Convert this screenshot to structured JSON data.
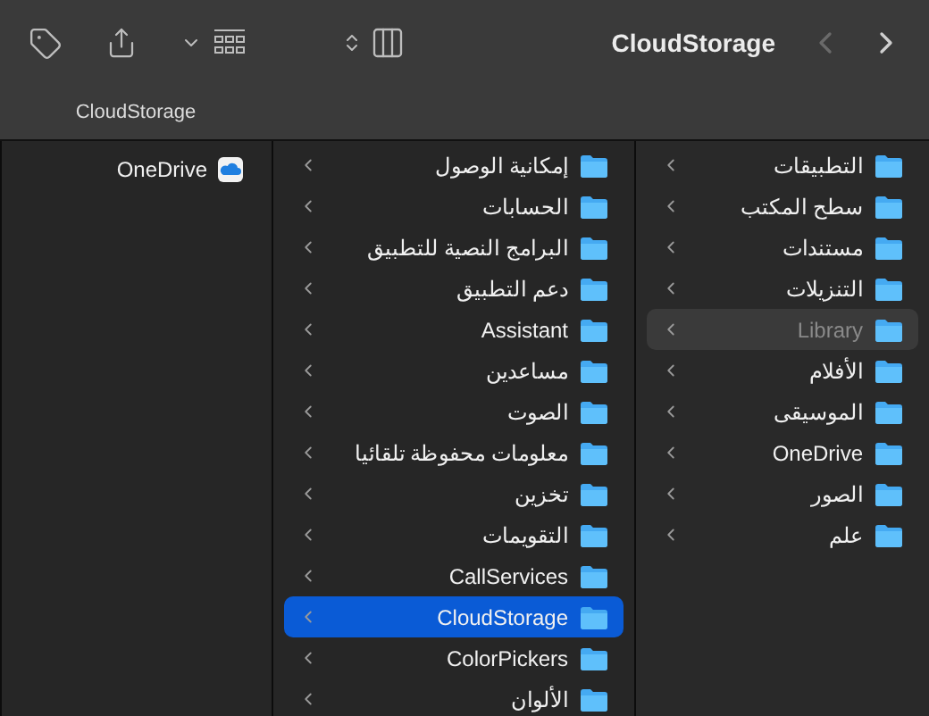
{
  "toolbar": {
    "title": "CloudStorage",
    "tab_label": "CloudStorage"
  },
  "columns": [
    {
      "active": false,
      "items": [
        {
          "label": "التطبيقات",
          "selected": false,
          "dimmed": false
        },
        {
          "label": "سطح المكتب",
          "selected": false,
          "dimmed": false
        },
        {
          "label": "مستندات",
          "selected": false,
          "dimmed": false
        },
        {
          "label": "التنزيلات",
          "selected": false,
          "dimmed": false
        },
        {
          "label": "Library",
          "selected": true,
          "dimmed": true
        },
        {
          "label": "الأفلام",
          "selected": false,
          "dimmed": false
        },
        {
          "label": "الموسيقى",
          "selected": false,
          "dimmed": false
        },
        {
          "label": "OneDrive",
          "selected": false,
          "dimmed": false
        },
        {
          "label": "الصور",
          "selected": false,
          "dimmed": false
        },
        {
          "label": "علم",
          "selected": false,
          "dimmed": false
        }
      ]
    },
    {
      "active": true,
      "items": [
        {
          "label": "إمكانية الوصول",
          "selected": false,
          "dimmed": false
        },
        {
          "label": "الحسابات",
          "selected": false,
          "dimmed": false
        },
        {
          "label": "البرامج النصية للتطبيق",
          "selected": false,
          "dimmed": false
        },
        {
          "label": "دعم التطبيق",
          "selected": false,
          "dimmed": false
        },
        {
          "label": "Assistant",
          "selected": false,
          "dimmed": false
        },
        {
          "label": "مساعدين",
          "selected": false,
          "dimmed": false
        },
        {
          "label": "الصوت",
          "selected": false,
          "dimmed": false
        },
        {
          "label": "معلومات محفوظة تلقائيا",
          "selected": false,
          "dimmed": false
        },
        {
          "label": "تخزين",
          "selected": false,
          "dimmed": false
        },
        {
          "label": "التقويمات",
          "selected": false,
          "dimmed": false
        },
        {
          "label": "CallServices",
          "selected": false,
          "dimmed": false
        },
        {
          "label": "CloudStorage",
          "selected": true,
          "dimmed": false
        },
        {
          "label": "ColorPickers",
          "selected": false,
          "dimmed": false
        },
        {
          "label": "الألوان",
          "selected": false,
          "dimmed": false
        }
      ]
    }
  ],
  "drives": [
    {
      "label": "OneDrive"
    }
  ]
}
